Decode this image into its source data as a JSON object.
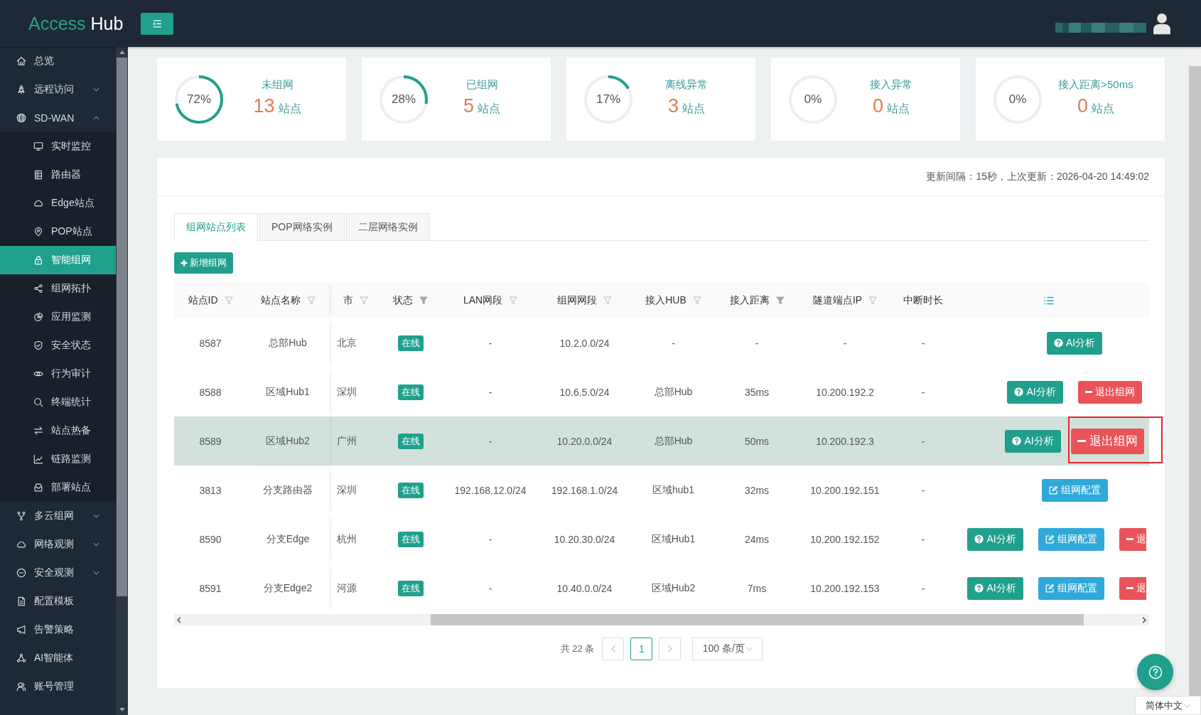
{
  "header": {
    "logo": {
      "primary": "Access",
      "secondary": "Hub"
    }
  },
  "sidebar": {
    "items": [
      {
        "label": "总览",
        "selected": false
      },
      {
        "label": "远程访问",
        "selected": false,
        "expanded": false
      },
      {
        "label": "SD-WAN",
        "selected": false,
        "expanded": true,
        "children": [
          {
            "label": "实时监控",
            "selected": false
          },
          {
            "label": "路由器",
            "selected": false
          },
          {
            "label": "Edge站点",
            "selected": false
          },
          {
            "label": "POP站点",
            "selected": false
          },
          {
            "label": "智能组网",
            "selected": true
          },
          {
            "label": "组网拓扑",
            "selected": false
          },
          {
            "label": "应用监测",
            "selected": false
          },
          {
            "label": "安全状态",
            "selected": false
          },
          {
            "label": "行为审计",
            "selected": false
          },
          {
            "label": "终端统计",
            "selected": false
          },
          {
            "label": "站点热备",
            "selected": false
          },
          {
            "label": "链路监测",
            "selected": false
          },
          {
            "label": "部署站点",
            "selected": false
          }
        ]
      },
      {
        "label": "多云组网",
        "selected": false,
        "expanded": false
      },
      {
        "label": "网络观测",
        "selected": false,
        "expanded": false
      },
      {
        "label": "安全观测",
        "selected": false,
        "expanded": false
      },
      {
        "label": "配置模板",
        "selected": false
      },
      {
        "label": "告警策略",
        "selected": false
      },
      {
        "label": "AI智能体",
        "selected": false
      },
      {
        "label": "账号管理",
        "selected": false
      }
    ]
  },
  "stats": [
    {
      "label": "未组网",
      "percent": "72%",
      "level": 0.72,
      "value": "13",
      "unit": "站点"
    },
    {
      "label": "已组网",
      "percent": "28%",
      "level": 0.28,
      "value": "5",
      "unit": "站点"
    },
    {
      "label": "离线异常",
      "percent": "17%",
      "level": 0.17,
      "value": "3",
      "unit": "站点"
    },
    {
      "label": "接入异常",
      "percent": "0%",
      "level": 0,
      "value": "0",
      "unit": "站点"
    },
    {
      "label": "接入距离>50ms",
      "percent": "0%",
      "level": 0,
      "value": "0",
      "unit": "站点"
    }
  ],
  "panel": {
    "update_info": "更新间隔：15秒，上次更新：2026-04-20 14:49:02",
    "tabs": [
      {
        "label": "组网站点列表",
        "selected": true
      },
      {
        "label": "POP网络实例",
        "selected": false
      },
      {
        "label": "二层网络实例",
        "selected": false
      }
    ],
    "add_button": {
      "label": "新增组网"
    },
    "table": {
      "columns": [
        {
          "label": "站点ID",
          "kind": "text",
          "filter_active": false
        },
        {
          "label": "站点名称",
          "kind": "text",
          "filter_active": false
        },
        {
          "label": "市",
          "kind": "text",
          "filter_active": false
        },
        {
          "label": "状态",
          "kind": "status",
          "filter_active": true
        },
        {
          "label": "LAN网段",
          "kind": "text",
          "filter_active": false
        },
        {
          "label": "组网网段",
          "kind": "text",
          "filter_active": false
        },
        {
          "label": "接入HUB",
          "kind": "text",
          "filter_active": false
        },
        {
          "label": "接入距离",
          "kind": "text",
          "filter_active": true
        },
        {
          "label": "隧道端点IP",
          "kind": "text",
          "filter_active": false
        },
        {
          "label": "中断时长",
          "kind": "text"
        },
        {
          "kind": "actions"
        }
      ],
      "rows": [
        {
          "selected": false,
          "cells": [
            "8587",
            "总部Hub",
            "北京",
            "在线",
            "-",
            "10.2.0.0/24",
            "-",
            "-",
            "-",
            "-"
          ],
          "actions": [
            {
              "kind": "ai",
              "label": "AI分析",
              "highlighted": false,
              "cut_off": false
            }
          ]
        },
        {
          "selected": false,
          "cells": [
            "8588",
            "区域Hub1",
            "深圳",
            "在线",
            "-",
            "10.6.5.0/24",
            "总部Hub",
            "35ms",
            "10.200.192.2",
            "-"
          ],
          "actions": [
            {
              "kind": "ai",
              "label": "AI分析",
              "highlighted": false,
              "cut_off": false
            },
            {
              "kind": "leave",
              "label": "退出组网",
              "highlighted": false,
              "cut_off": false
            }
          ]
        },
        {
          "selected": true,
          "cells": [
            "8589",
            "区域Hub2",
            "广州",
            "在线",
            "-",
            "10.20.0.0/24",
            "总部Hub",
            "50ms",
            "10.200.192.3",
            "-"
          ],
          "actions": [
            {
              "kind": "ai",
              "label": "AI分析",
              "highlighted": false,
              "cut_off": false
            },
            {
              "kind": "leave",
              "label": "退出组网",
              "highlighted": true,
              "cut_off": false
            }
          ]
        },
        {
          "selected": false,
          "cells": [
            "3813",
            "分支路由器",
            "深圳",
            "在线",
            "192.168.12.0/24",
            "192.168.1.0/24",
            "区域hub1",
            "32ms",
            "10.200.192.151",
            "-"
          ],
          "actions": [
            {
              "kind": "config",
              "label": "组网配置",
              "highlighted": false,
              "cut_off": false
            }
          ]
        },
        {
          "selected": false,
          "cells": [
            "8590",
            "分支Edge",
            "杭州",
            "在线",
            "-",
            "10.20.30.0/24",
            "区域Hub1",
            "24ms",
            "10.200.192.152",
            "-"
          ],
          "actions": [
            {
              "kind": "ai",
              "label": "AI分析",
              "highlighted": false,
              "cut_off": false
            },
            {
              "kind": "config",
              "label": "组网配置",
              "highlighted": false,
              "cut_off": false
            },
            {
              "kind": "leave",
              "label": "退",
              "highlighted": false,
              "cut_off": true
            }
          ]
        },
        {
          "selected": false,
          "cells": [
            "8591",
            "分支Edge2",
            "河源",
            "在线",
            "-",
            "10.40.0.0/24",
            "区域Hub2",
            "7ms",
            "10.200.192.153",
            "-"
          ],
          "actions": [
            {
              "kind": "ai",
              "label": "AI分析",
              "highlighted": false,
              "cut_off": false
            },
            {
              "kind": "config",
              "label": "组网配置",
              "highlighted": false,
              "cut_off": false
            },
            {
              "kind": "leave",
              "label": "退",
              "highlighted": false,
              "cut_off": true
            }
          ]
        }
      ]
    },
    "pagination": {
      "total": "共 22 条",
      "prev": {
        "disabled": true
      },
      "pages": [
        {
          "label": "1",
          "selected": true
        }
      ],
      "next": {
        "disabled": true
      },
      "page_size": "100 条/页"
    }
  },
  "language_select": {
    "label": "简体中文"
  }
}
